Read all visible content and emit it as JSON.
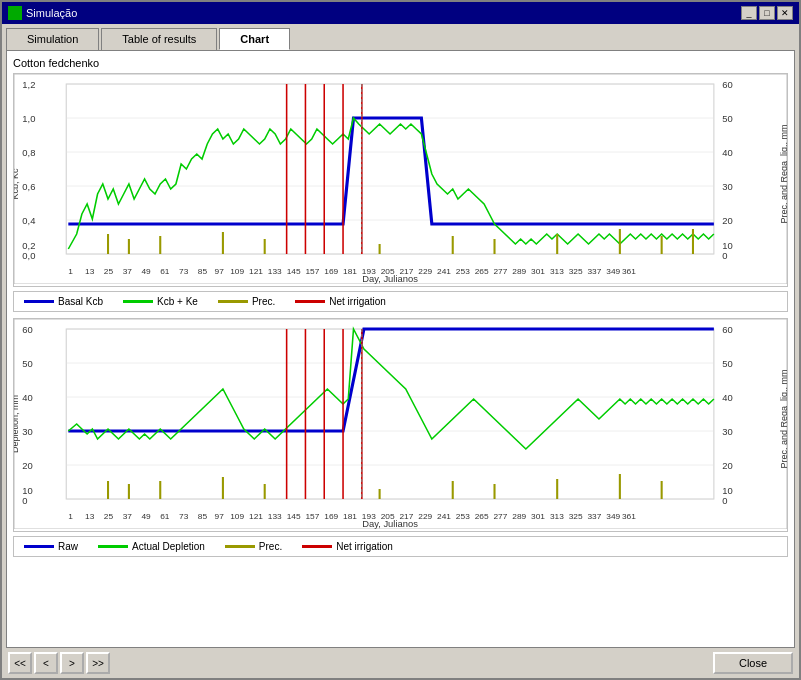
{
  "window": {
    "title": "Simulação",
    "title_icon": "sim-icon"
  },
  "tabs": [
    {
      "id": "simulation",
      "label": "Simulation",
      "active": false
    },
    {
      "id": "table",
      "label": "Table of results",
      "active": false
    },
    {
      "id": "chart",
      "label": "Chart",
      "active": true
    }
  ],
  "chart": {
    "subtitle": "Cotton fedchenko",
    "top_chart": {
      "y_left_label": "Kcb, Kc",
      "y_right_label": "Prec. and Rega_liq., mm",
      "x_label": "Day, Julianos"
    },
    "top_legend": [
      {
        "id": "basal-kcb",
        "label": "Basal Kcb",
        "color": "#0000cc",
        "thickness": 3
      },
      {
        "id": "kcb-ke",
        "label": "Kcb + Ke",
        "color": "#00cc00",
        "thickness": 2
      },
      {
        "id": "prec",
        "label": "Prec.",
        "color": "#999900",
        "thickness": 2
      },
      {
        "id": "net-irrigation",
        "label": "Net irrigation",
        "color": "#cc0000",
        "thickness": 2
      }
    ],
    "bottom_chart": {
      "y_left_label": "Depletion, mm",
      "y_right_label": "Prec. and Rega_liq., mm",
      "x_label": "Day, Julianos"
    },
    "bottom_legend": [
      {
        "id": "raw",
        "label": "Raw",
        "color": "#0000cc",
        "thickness": 3
      },
      {
        "id": "actual-depletion",
        "label": "Actual Depletion",
        "color": "#00cc00",
        "thickness": 2
      },
      {
        "id": "prec2",
        "label": "Prec.",
        "color": "#999900",
        "thickness": 2
      },
      {
        "id": "net-irrigation2",
        "label": "Net irrigation",
        "color": "#cc0000",
        "thickness": 2
      }
    ]
  },
  "nav": {
    "first_label": "<<",
    "prev_label": "<",
    "next_label": ">",
    "last_label": ">>"
  },
  "footer": {
    "close_label": "Close"
  },
  "title_controls": {
    "minimize": "_",
    "maximize": "□",
    "close": "✕"
  }
}
